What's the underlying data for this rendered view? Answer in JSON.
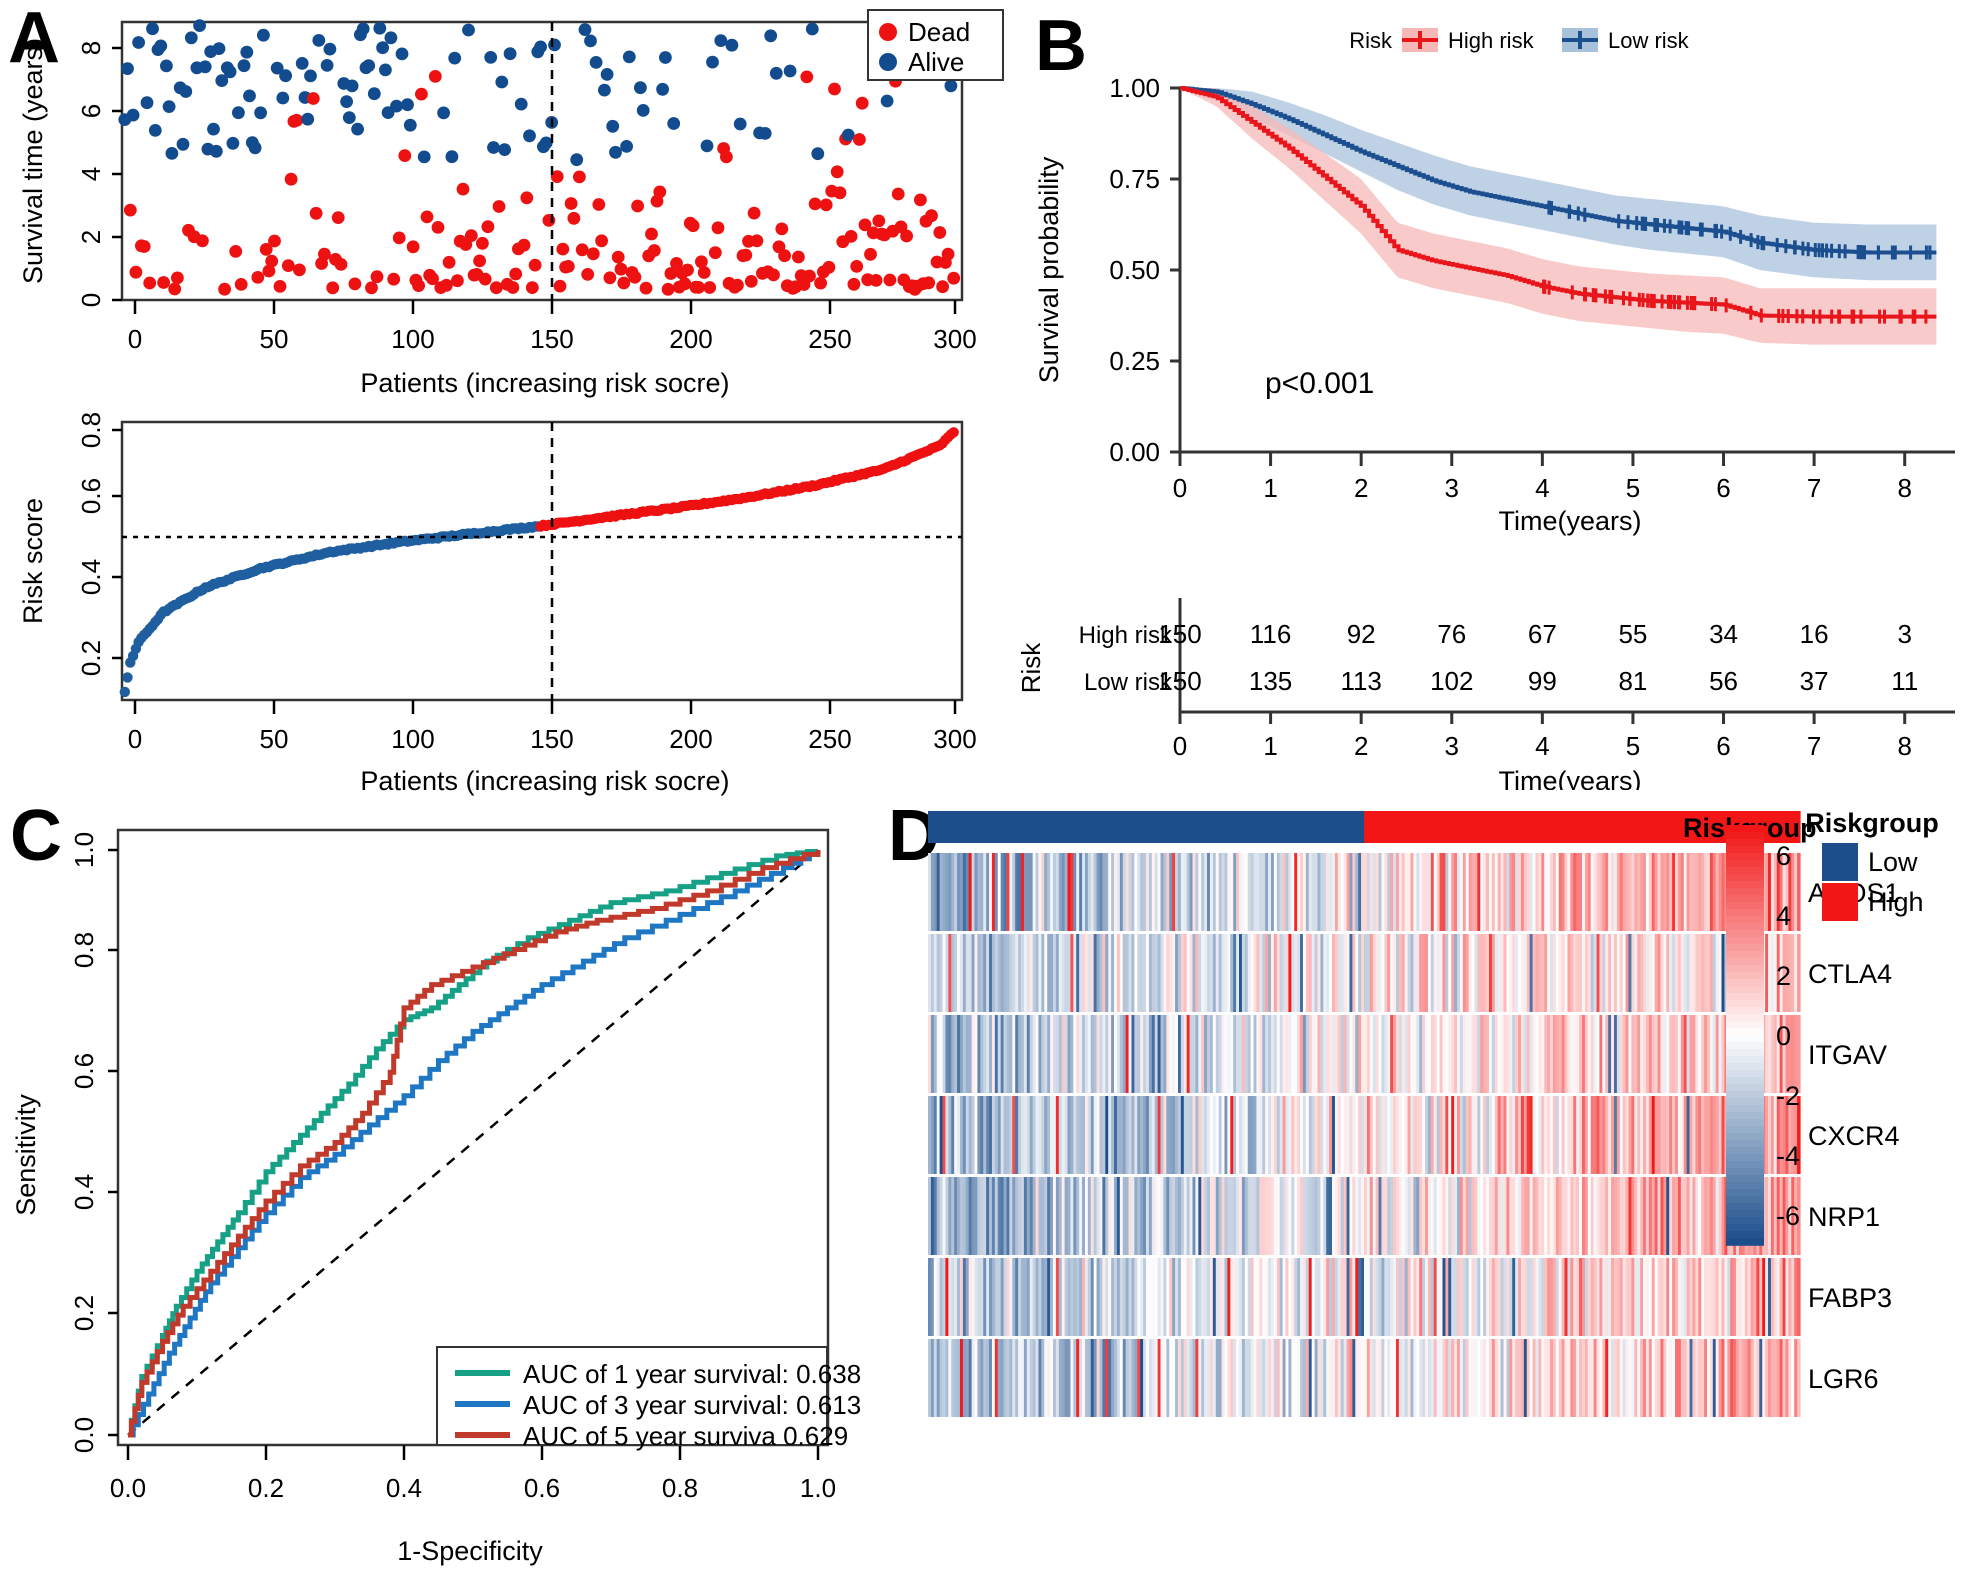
{
  "figure": {
    "panels": [
      {
        "id": "A",
        "label": "A"
      },
      {
        "id": "B",
        "label": "B"
      },
      {
        "id": "C",
        "label": "C"
      },
      {
        "id": "D",
        "label": "D"
      }
    ]
  },
  "panelA": {
    "scatter": {
      "ylabel": "Survival time (years)",
      "xlabel": "Patients (increasing risk socre)",
      "yticks": [
        "0",
        "2",
        "4",
        "6",
        "8"
      ],
      "xticks": [
        "0",
        "50",
        "100",
        "150",
        "200",
        "250",
        "300"
      ],
      "legend": [
        {
          "label": "Dead",
          "color": "#EE1111"
        },
        {
          "label": "Alive",
          "color": "#124C8F"
        }
      ],
      "cutoff": 150
    },
    "riskcurve": {
      "ylabel": "Risk score",
      "xlabel": "Patients (increasing risk socre)",
      "yticks": [
        "0.2",
        "0.4",
        "0.6",
        "0.8"
      ],
      "xticks": [
        "0",
        "50",
        "100",
        "150",
        "200",
        "250",
        "300"
      ],
      "cutoff_x": 150,
      "cutoff_y": 0.555,
      "low_color": "#1F5FA0",
      "high_color": "#EE1111"
    }
  },
  "panelB": {
    "legend_title": "Risk",
    "legend_items": [
      {
        "label": "High risk",
        "color": "#E8161B",
        "band": "#F7B8B8"
      },
      {
        "label": "Low risk",
        "color": "#1B4F8F",
        "band": "#A9C2DC"
      }
    ],
    "ylabel": "Survival probability",
    "xlabel": "Time(years)",
    "yticks": [
      "0.00",
      "0.25",
      "0.50",
      "0.75",
      "1.00"
    ],
    "xticks": [
      "0",
      "1",
      "2",
      "3",
      "4",
      "5",
      "6",
      "7",
      "8"
    ],
    "pvalue": "p<0.001",
    "risk_table": {
      "axis_label": "Risk",
      "xlabel": "Time(years)",
      "xticks": [
        "0",
        "1",
        "2",
        "3",
        "4",
        "5",
        "6",
        "7",
        "8"
      ],
      "rows": [
        {
          "label": "High risk",
          "color": "#E8161B",
          "counts": [
            150,
            116,
            92,
            76,
            67,
            55,
            34,
            16,
            3
          ]
        },
        {
          "label": "Low risk",
          "color": "#1B4F8F",
          "counts": [
            150,
            135,
            113,
            102,
            99,
            81,
            56,
            37,
            11
          ]
        }
      ]
    }
  },
  "panelC": {
    "ylabel": "Sensitivity",
    "xlabel": "1-Specificity",
    "yticks": [
      "0.0",
      "0.2",
      "0.4",
      "0.6",
      "0.8",
      "1.0"
    ],
    "xticks": [
      "0.0",
      "0.2",
      "0.4",
      "0.6",
      "0.8",
      "1.0"
    ],
    "legend": [
      {
        "label": "AUC of 1 year survival:  0.638",
        "color": "#16A085",
        "auc": 0.638
      },
      {
        "label": "AUC of 3 year survival:  0.613",
        "color": "#1F77C4",
        "auc": 0.613
      },
      {
        "label": "AUC of 5 year surviva 0.629",
        "color": "#C0392B",
        "auc": 0.629
      }
    ]
  },
  "panelD": {
    "annotation_label": "Riskgroup",
    "genes": [
      "ANOS1",
      "CTLA4",
      "ITGAV",
      "CXCR4",
      "NRP1",
      "FABP3",
      "LGR6"
    ],
    "colorbar_ticks": [
      "6",
      "4",
      "2",
      "0",
      "-2",
      "-4",
      "-6"
    ],
    "colorbar_range": [
      -7,
      7
    ],
    "legend_title": "Riskgroup",
    "legend_items": [
      {
        "label": "Low",
        "color": "#1C4E8C"
      },
      {
        "label": "High",
        "color": "#F21616"
      }
    ],
    "n_samples": 300,
    "low_fraction": 0.5
  },
  "chart_data": [
    {
      "type": "scatter",
      "panel": "A-top",
      "title": "",
      "xlabel": "Patients (increasing risk socre)",
      "ylabel": "Survival time (years)",
      "xlim": [
        0,
        303
      ],
      "ylim": [
        -0.3,
        8.9
      ],
      "legend_position": "top-right",
      "grid": false,
      "series": [
        {
          "name": "Dead",
          "color": "#EE1111"
        },
        {
          "name": "Alive",
          "color": "#124C8F"
        }
      ],
      "annotations": [
        {
          "type": "vline",
          "x": 150,
          "style": "dashed"
        }
      ],
      "note": "Alive (blue) points cluster above ~4.3 years; Dead (red) points cluster below ~4 years, with density of red increasing to the right of the x=150 cutoff."
    },
    {
      "type": "line",
      "panel": "A-bottom",
      "title": "",
      "xlabel": "Patients (increasing risk socre)",
      "ylabel": "Risk score",
      "xlim": [
        0,
        303
      ],
      "ylim": [
        0.13,
        0.81
      ],
      "grid": false,
      "series": [
        {
          "name": "Low risk",
          "color": "#1F5FA0",
          "x_range": [
            1,
            150
          ]
        },
        {
          "name": "High risk",
          "color": "#EE1111",
          "x_range": [
            150,
            300
          ]
        }
      ],
      "annotations": [
        {
          "type": "vline",
          "x": 150,
          "style": "dashed"
        },
        {
          "type": "hline",
          "y": 0.555,
          "style": "dashed"
        }
      ],
      "key_points": [
        {
          "x": 1,
          "y": 0.148
        },
        {
          "x": 3,
          "y": 0.222
        },
        {
          "x": 6,
          "y": 0.272
        },
        {
          "x": 15,
          "y": 0.345
        },
        {
          "x": 30,
          "y": 0.405
        },
        {
          "x": 50,
          "y": 0.452
        },
        {
          "x": 75,
          "y": 0.492
        },
        {
          "x": 100,
          "y": 0.516
        },
        {
          "x": 125,
          "y": 0.536
        },
        {
          "x": 150,
          "y": 0.555
        },
        {
          "x": 175,
          "y": 0.578
        },
        {
          "x": 200,
          "y": 0.6
        },
        {
          "x": 225,
          "y": 0.625
        },
        {
          "x": 250,
          "y": 0.655
        },
        {
          "x": 275,
          "y": 0.695
        },
        {
          "x": 295,
          "y": 0.752
        },
        {
          "x": 300,
          "y": 0.785
        }
      ]
    },
    {
      "type": "line",
      "panel": "B",
      "title": "",
      "xlabel": "Time(years)",
      "ylabel": "Survival probability",
      "xlim": [
        0,
        8.5
      ],
      "ylim": [
        0,
        1
      ],
      "grid": false,
      "legend_position": "top",
      "annotation_text": "p<0.001",
      "series": [
        {
          "name": "High risk",
          "color": "#E8161B",
          "x": [
            0,
            0.4,
            0.8,
            1.2,
            1.6,
            2.0,
            2.4,
            2.8,
            3.2,
            3.6,
            4.0,
            4.4,
            4.8,
            5.2,
            5.6,
            6.0,
            6.4,
            7.0,
            7.6,
            8.3
          ],
          "y": [
            1.0,
            0.975,
            0.905,
            0.835,
            0.755,
            0.675,
            0.555,
            0.525,
            0.505,
            0.485,
            0.455,
            0.435,
            0.425,
            0.415,
            0.41,
            0.405,
            0.375,
            0.372,
            0.372,
            0.372
          ],
          "ci_lower": [
            1.0,
            0.95,
            0.86,
            0.78,
            0.69,
            0.6,
            0.48,
            0.45,
            0.43,
            0.41,
            0.38,
            0.36,
            0.35,
            0.34,
            0.33,
            0.325,
            0.3,
            0.295,
            0.295,
            0.295
          ],
          "ci_upper": [
            1.0,
            1.0,
            0.95,
            0.89,
            0.82,
            0.75,
            0.63,
            0.6,
            0.58,
            0.56,
            0.53,
            0.51,
            0.5,
            0.49,
            0.485,
            0.48,
            0.45,
            0.45,
            0.45,
            0.45
          ]
        },
        {
          "name": "Low risk",
          "color": "#1B4F8F",
          "x": [
            0,
            0.4,
            0.8,
            1.2,
            1.6,
            2.0,
            2.4,
            2.8,
            3.2,
            3.6,
            4.0,
            4.4,
            4.8,
            5.2,
            5.6,
            6.0,
            6.4,
            7.0,
            7.6,
            8.3
          ],
          "y": [
            1.0,
            0.99,
            0.955,
            0.915,
            0.87,
            0.825,
            0.785,
            0.745,
            0.715,
            0.695,
            0.675,
            0.655,
            0.635,
            0.625,
            0.615,
            0.605,
            0.575,
            0.555,
            0.548,
            0.548
          ],
          "ci_lower": [
            1.0,
            0.97,
            0.92,
            0.87,
            0.82,
            0.77,
            0.72,
            0.68,
            0.65,
            0.63,
            0.61,
            0.59,
            0.57,
            0.555,
            0.545,
            0.535,
            0.5,
            0.48,
            0.472,
            0.472
          ],
          "ci_upper": [
            1.0,
            1.0,
            0.99,
            0.96,
            0.925,
            0.885,
            0.85,
            0.815,
            0.785,
            0.765,
            0.745,
            0.725,
            0.705,
            0.695,
            0.685,
            0.675,
            0.65,
            0.63,
            0.625,
            0.625
          ]
        }
      ]
    },
    {
      "type": "line",
      "panel": "C",
      "title": "",
      "xlabel": "1-Specificity",
      "ylabel": "Sensitivity",
      "xlim": [
        0,
        1
      ],
      "ylim": [
        0,
        1
      ],
      "grid": false,
      "legend_position": "bottom-right",
      "annotations": [
        {
          "type": "diagonal-reference",
          "style": "dashed"
        }
      ],
      "series": [
        {
          "name": "AUC of 1 year survival:  0.638",
          "color": "#16A085",
          "auc": 0.638,
          "x": [
            0,
            0.02,
            0.05,
            0.07,
            0.1,
            0.13,
            0.16,
            0.2,
            0.24,
            0.28,
            0.32,
            0.36,
            0.4,
            0.44,
            0.48,
            0.52,
            0.58,
            0.64,
            0.7,
            0.78,
            0.86,
            0.94,
            1.0
          ],
          "y": [
            0,
            0.1,
            0.17,
            0.22,
            0.28,
            0.33,
            0.38,
            0.45,
            0.5,
            0.55,
            0.6,
            0.66,
            0.71,
            0.73,
            0.77,
            0.81,
            0.85,
            0.88,
            0.91,
            0.93,
            0.96,
            0.99,
            1.0
          ]
        },
        {
          "name": "AUC of 3 year survival:  0.613",
          "color": "#1F77C4",
          "auc": 0.613,
          "x": [
            0,
            0.03,
            0.06,
            0.09,
            0.12,
            0.16,
            0.2,
            0.25,
            0.3,
            0.35,
            0.4,
            0.45,
            0.5,
            0.55,
            0.6,
            0.66,
            0.72,
            0.8,
            0.88,
            0.95,
            1.0
          ],
          "y": [
            0,
            0.07,
            0.14,
            0.2,
            0.26,
            0.32,
            0.38,
            0.44,
            0.48,
            0.53,
            0.58,
            0.64,
            0.69,
            0.73,
            0.77,
            0.81,
            0.85,
            0.89,
            0.93,
            0.97,
            1.0
          ]
        },
        {
          "name": "AUC of 5 year surviva 0.629",
          "color": "#C0392B",
          "auc": 0.629,
          "x": [
            0,
            0.02,
            0.05,
            0.08,
            0.12,
            0.16,
            0.2,
            0.25,
            0.3,
            0.34,
            0.38,
            0.4,
            0.44,
            0.5,
            0.56,
            0.62,
            0.68,
            0.76,
            0.84,
            0.92,
            1.0
          ],
          "y": [
            0,
            0.09,
            0.16,
            0.22,
            0.28,
            0.34,
            0.4,
            0.46,
            0.5,
            0.55,
            0.62,
            0.73,
            0.77,
            0.8,
            0.83,
            0.86,
            0.88,
            0.9,
            0.93,
            0.97,
            1.0
          ]
        }
      ]
    },
    {
      "type": "heatmap",
      "panel": "D",
      "rows": [
        "ANOS1",
        "CTLA4",
        "ITGAV",
        "CXCR4",
        "NRP1",
        "FABP3",
        "LGR6"
      ],
      "columns": 300,
      "column_annotation": {
        "name": "Riskgroup",
        "groups": [
          "Low",
          "High"
        ],
        "split_at": 150
      },
      "colorscale": {
        "low": "#1C4E8C",
        "mid": "#FFFFFF",
        "high": "#F21616",
        "vmin": -7,
        "vmax": 7
      },
      "colorbar_ticks": [
        6,
        4,
        2,
        0,
        -2,
        -4,
        -6
      ],
      "note": "Columns sorted by increasing risk score; left half Low risk (blue annotation), right half High risk (red annotation). Most genes show blue (low expression) on left and red (high expression) on right."
    }
  ]
}
